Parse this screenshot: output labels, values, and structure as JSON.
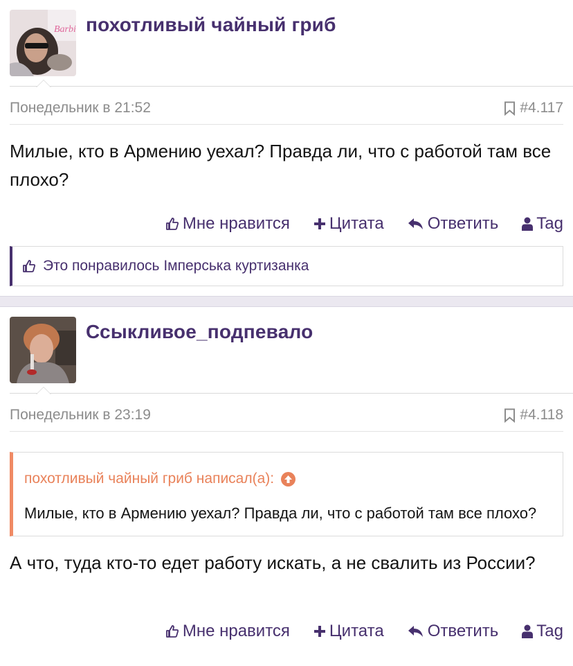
{
  "posts": [
    {
      "username": "похотливый чайный гриб",
      "date": "Понедельник в 21:52",
      "number": "#4.117",
      "message": "Милые, кто в Армению уехал? Правда ли, что с работой там все плохо?",
      "likes_text": "Это понравилось Імперська куртизанка"
    },
    {
      "username": "Ссыкливое_подпевало",
      "date": "Понедельник в 23:19",
      "number": "#4.118",
      "quote": {
        "author_line": "похотливый чайный гриб написал(а):",
        "text": "Милые, кто в Армению уехал? Правда ли, что с работой там все плохо?"
      },
      "message": "А что, туда кто-то едет работу искать, а не свалить из России?"
    }
  ],
  "actions": {
    "like": "Мне нравится",
    "quote": "Цитата",
    "reply": "Ответить",
    "tag": "Tag"
  },
  "colors": {
    "accent": "#47306e",
    "quote_accent": "#f08a64",
    "meta": "#8c8c8c"
  }
}
